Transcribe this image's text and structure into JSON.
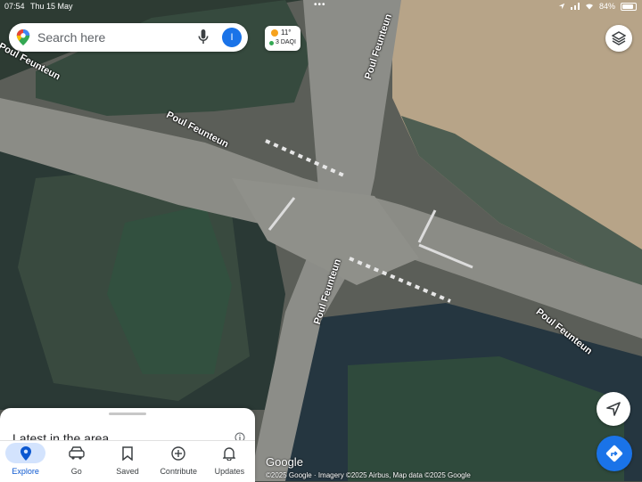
{
  "status_bar": {
    "time": "07:54",
    "date": "Thu 15 May",
    "battery": "84%",
    "battery_level": 0.84
  },
  "search": {
    "placeholder": "Search here",
    "avatar_initial": "I",
    "icon": "maps-pin-icon"
  },
  "weather": {
    "temperature": "11°",
    "air_quality": "3 DAQI"
  },
  "map": {
    "road_labels": [
      "Poul Feunteun",
      "Poul Feunteun",
      "Poul Feunteun",
      "Poul Feunteun",
      "Poul Feunteun"
    ],
    "google_logo": "Google",
    "attribution": "©2025 Google · Imagery ©2025 Airbus, Map data ©2025 Google"
  },
  "sheet": {
    "title": "Latest in the area"
  },
  "bottom_nav": {
    "items": [
      {
        "label": "Explore",
        "icon": "explore-pin-icon",
        "active": true
      },
      {
        "label": "Go",
        "icon": "car-icon",
        "active": false
      },
      {
        "label": "Saved",
        "icon": "bookmark-icon",
        "active": false
      },
      {
        "label": "Contribute",
        "icon": "plus-circle-icon",
        "active": false
      },
      {
        "label": "Updates",
        "icon": "bell-icon",
        "active": false
      }
    ]
  },
  "colors": {
    "accent": "#1a73e8",
    "active_pill": "#d3e3fd"
  }
}
